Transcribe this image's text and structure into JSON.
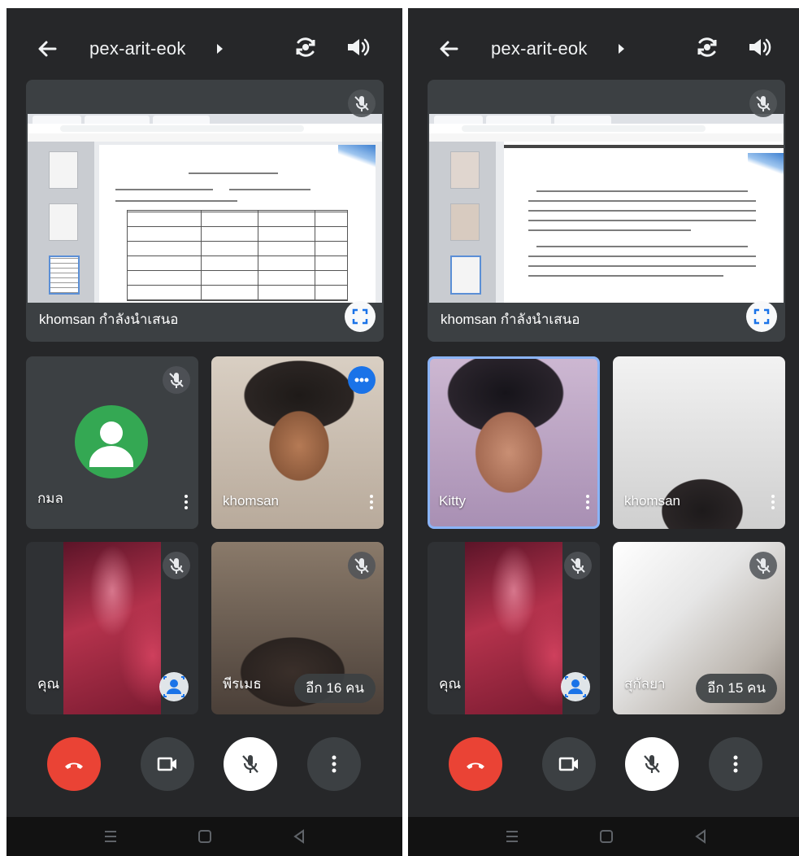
{
  "screens": [
    {
      "header": {
        "meeting_code": "pex-arit-eok",
        "back_icon": "arrow-left-icon",
        "switch_camera_icon": "switch-camera-icon",
        "audio_icon": "speaker-icon"
      },
      "presentation": {
        "label": "khomsan กำลังนำเสนอ",
        "muted": true
      },
      "tiles": [
        {
          "name": "กมล",
          "type": "avatar",
          "muted": true,
          "menu": true
        },
        {
          "name": "khomsan",
          "type": "video",
          "speaking": true,
          "menu": true
        },
        {
          "name": "คุณ",
          "type": "self",
          "muted": true,
          "background_effect": true
        },
        {
          "name": "พีรเมธ",
          "type": "video",
          "muted": true,
          "overflow_label": "อีก 16 คน"
        }
      ],
      "controls": {
        "end_call_icon": "end-call-icon",
        "camera_icon": "camera-icon",
        "mic_icon": "mic-off-icon",
        "more_icon": "more-vert-icon"
      }
    },
    {
      "header": {
        "meeting_code": "pex-arit-eok",
        "back_icon": "arrow-left-icon",
        "switch_camera_icon": "switch-camera-icon",
        "audio_icon": "speaker-icon"
      },
      "presentation": {
        "label": "khomsan กำลังนำเสนอ",
        "muted": true
      },
      "tiles": [
        {
          "name": "Kitty",
          "type": "video",
          "active_speaker": true,
          "menu": true
        },
        {
          "name": "khomsan",
          "type": "video",
          "menu": true
        },
        {
          "name": "คุณ",
          "type": "self",
          "muted": true,
          "background_effect": true
        },
        {
          "name": "สุกัลยา",
          "type": "video",
          "muted": true,
          "overflow_label": "อีก 15 คน"
        }
      ],
      "controls": {
        "end_call_icon": "end-call-icon",
        "camera_icon": "camera-icon",
        "mic_icon": "mic-off-icon",
        "more_icon": "more-vert-icon"
      }
    }
  ],
  "colors": {
    "background": "#262729",
    "tile": "#3c4043",
    "end_call": "#ea4335",
    "speaking": "#1a73e8",
    "active_border": "#8ab4f8"
  }
}
